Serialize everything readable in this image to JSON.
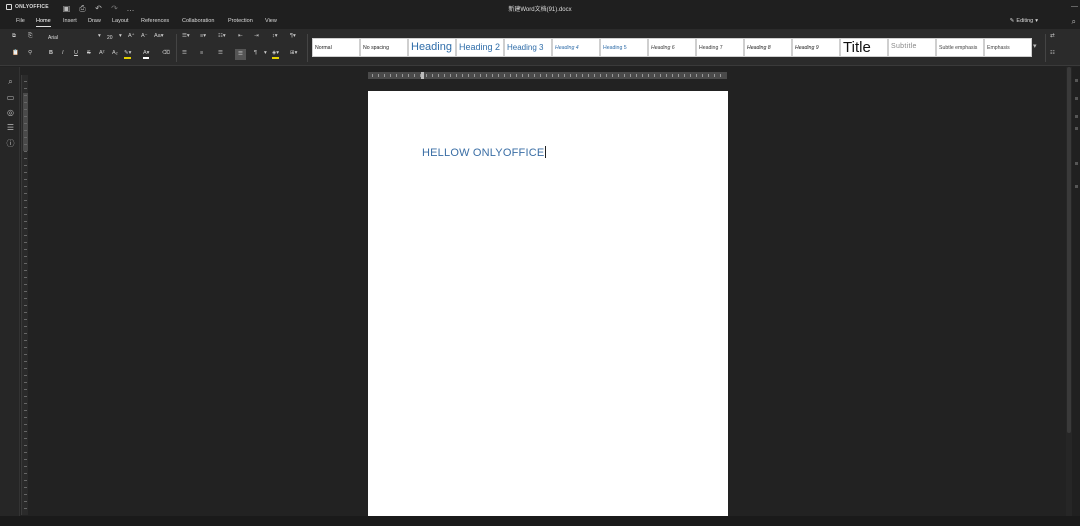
{
  "app": {
    "brand": "ONLYOFFICE",
    "document_title": "新建Word文档(91).docx"
  },
  "menu": {
    "tabs": [
      "File",
      "Home",
      "Insert",
      "Draw",
      "Layout",
      "References",
      "Collaboration",
      "Protection",
      "View"
    ],
    "active_tab": "Home",
    "mode_label": "Editing"
  },
  "toolbar": {
    "font_name": "Arial",
    "font_size": "20",
    "row1_icons": [
      "copy-icon",
      "paste-special-icon",
      "font-increase-icon",
      "font-decrease-icon",
      "change-case-icon",
      "bullets-icon",
      "numbering-icon",
      "multilevel-icon",
      "decrease-indent-icon",
      "line-spacing-icon",
      "sort-icon"
    ],
    "row2_labels": {
      "bold": "B",
      "italic": "I",
      "underline": "U",
      "strike": "S",
      "superscript": "A²",
      "subscript": "A₂",
      "pilcrow": "¶"
    }
  },
  "styles": [
    {
      "label": "Normal",
      "cls": ""
    },
    {
      "label": "No spacing",
      "cls": ""
    },
    {
      "label": "Heading",
      "cls": "h1"
    },
    {
      "label": "Heading 2",
      "cls": "h2"
    },
    {
      "label": "Heading 3",
      "cls": "h3"
    },
    {
      "label": "Heading 4",
      "cls": "h4"
    },
    {
      "label": "Heading 5",
      "cls": "h5"
    },
    {
      "label": "Heading 6",
      "cls": "h6"
    },
    {
      "label": "Heading 7",
      "cls": "h7"
    },
    {
      "label": "Heading 8",
      "cls": "h8"
    },
    {
      "label": "Heading 9",
      "cls": "h9"
    },
    {
      "label": "Title",
      "cls": "title"
    },
    {
      "label": "Subtitle",
      "cls": "subtitle"
    },
    {
      "label": "Subtle emphasis",
      "cls": "subtle"
    },
    {
      "label": "Emphasis",
      "cls": "emph"
    }
  ],
  "document": {
    "text": "HELLOW ONLYOFFICE"
  },
  "colors": {
    "accent": "#3a6ea5",
    "toolbar_bg": "#2b2b2b",
    "canvas_bg": "#222222",
    "page_bg": "#ffffff"
  }
}
